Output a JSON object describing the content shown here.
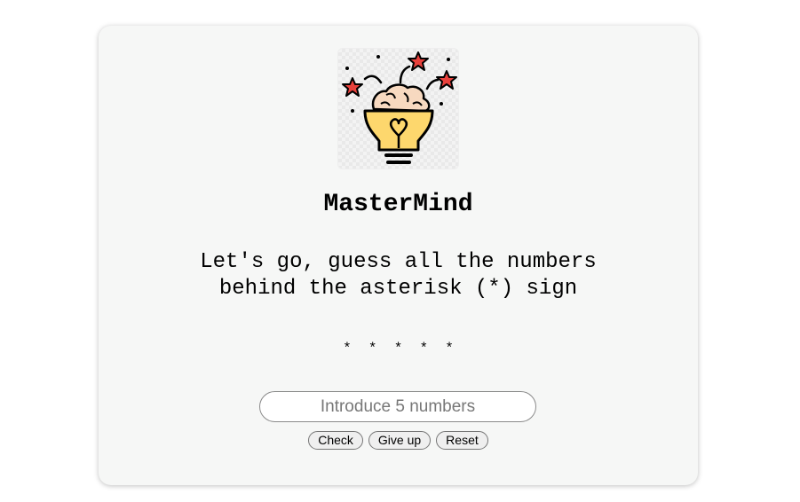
{
  "app": {
    "title": "MasterMind",
    "subtitle_line1": "Let's go, guess all the numbers",
    "subtitle_line2": "behind the asterisk (*) sign",
    "secret_display": "*  *  *  *  *"
  },
  "logo": {
    "icon": "brain-lightbulb-icon",
    "accent": "#fdd76d",
    "star_color": "#e8413c"
  },
  "guess": {
    "value": "",
    "placeholder": "Introduce 5 numbers"
  },
  "actions": {
    "check_label": "Check",
    "give_up_label": "Give up",
    "reset_label": "Reset"
  }
}
